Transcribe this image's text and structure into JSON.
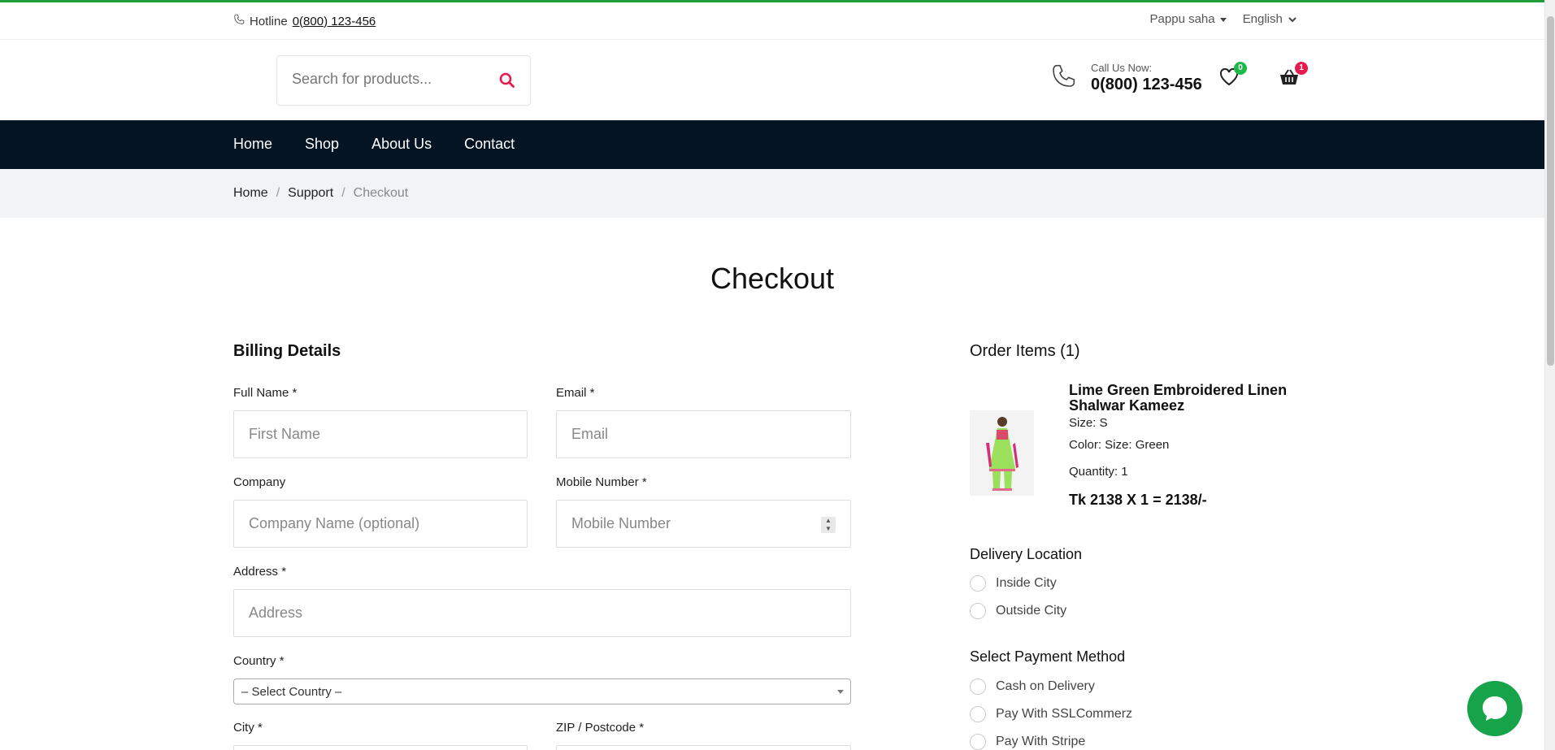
{
  "topbar": {
    "hotline_label": "Hotline",
    "hotline_number": "0(800) 123-456",
    "user": "Pappu saha",
    "language": "English"
  },
  "header": {
    "search_placeholder": "Search for products...",
    "call_label": "Call Us Now:",
    "call_number": "0(800) 123-456",
    "wishlist_count": "0",
    "cart_count": "1"
  },
  "nav": {
    "items": [
      "Home",
      "Shop",
      "About Us",
      "Contact"
    ]
  },
  "breadcrumb": {
    "items": [
      "Home",
      "Support",
      "Checkout"
    ],
    "separator": "/"
  },
  "page_title": "Checkout",
  "billing": {
    "title": "Billing Details",
    "full_name_label": "Full Name *",
    "full_name_placeholder": "First Name",
    "email_label": "Email *",
    "email_placeholder": "Email",
    "company_label": "Company",
    "company_placeholder": "Company Name (optional)",
    "mobile_label": "Mobile Number *",
    "mobile_placeholder": "Mobile Number",
    "address_label": "Address *",
    "address_placeholder": "Address",
    "country_label": "Country *",
    "country_value": "– Select Country –",
    "city_label": "City *",
    "zip_label": "ZIP / Postcode *"
  },
  "order": {
    "title": "Order Items (1)",
    "product_name": "Lime Green Embroidered Linen Shalwar Kameez",
    "size": "Size: S",
    "color": "Color: Size: Green",
    "quantity": "Quantity: 1",
    "total": "Tk 2138 X 1 = 2138/-"
  },
  "delivery": {
    "title": "Delivery Location",
    "options": [
      "Inside City",
      "Outside City"
    ]
  },
  "payment": {
    "title": "Select Payment Method",
    "options": [
      "Cash on Delivery",
      "Pay With SSLCommerz",
      "Pay With Stripe"
    ]
  },
  "colors": {
    "nav_bg": "#041422",
    "accent": "#e8194f",
    "green": "#1f9d3a"
  }
}
